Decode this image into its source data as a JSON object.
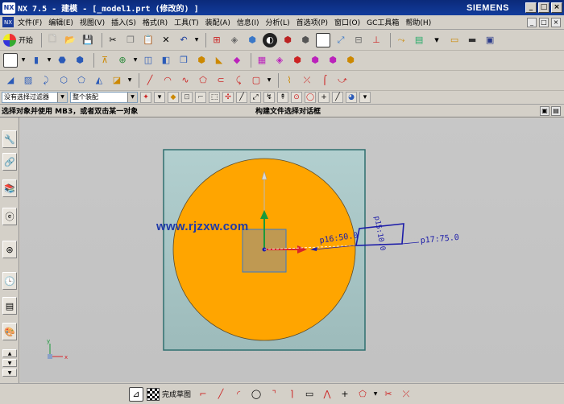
{
  "titlebar": {
    "app_logo": "NX",
    "title": "NX 7.5 - 建模 - [_model1.prt  (修改的) ]",
    "brand": "SIEMENS",
    "buttons": [
      "_",
      "□",
      "×"
    ]
  },
  "menubar": {
    "items": [
      "文件(F)",
      "编辑(E)",
      "视图(V)",
      "插入(S)",
      "格式(R)",
      "工具(T)",
      "装配(A)",
      "信息(I)",
      "分析(L)",
      "首选项(P)",
      "窗口(O)",
      "GC工具箱",
      "帮助(H)"
    ],
    "right_buttons": [
      "_",
      "□",
      "×"
    ]
  },
  "toolbar1": {
    "start_label": "开始"
  },
  "filterbar": {
    "type_filter_value": "没有选择过滤器",
    "scope_value": "整个装配"
  },
  "statusbar": {
    "prompt": "选择对象并使用 MB3，或者双击某一对象",
    "message": "构建文件选择对话框"
  },
  "sketch": {
    "dim_p16": "p16:50.0",
    "dim_p15": "p15:10.0",
    "dim_p17": "p17:75.0",
    "watermark": "www.rjzxw.com",
    "triad_x": "x",
    "triad_y": "y"
  },
  "bottombar": {
    "finish_label": "完成草图"
  },
  "colors": {
    "circle": "#ffa500",
    "plane": "#a9c7c7",
    "dimension": "#1c1ca8",
    "titlebar": "#0b2a7a"
  }
}
